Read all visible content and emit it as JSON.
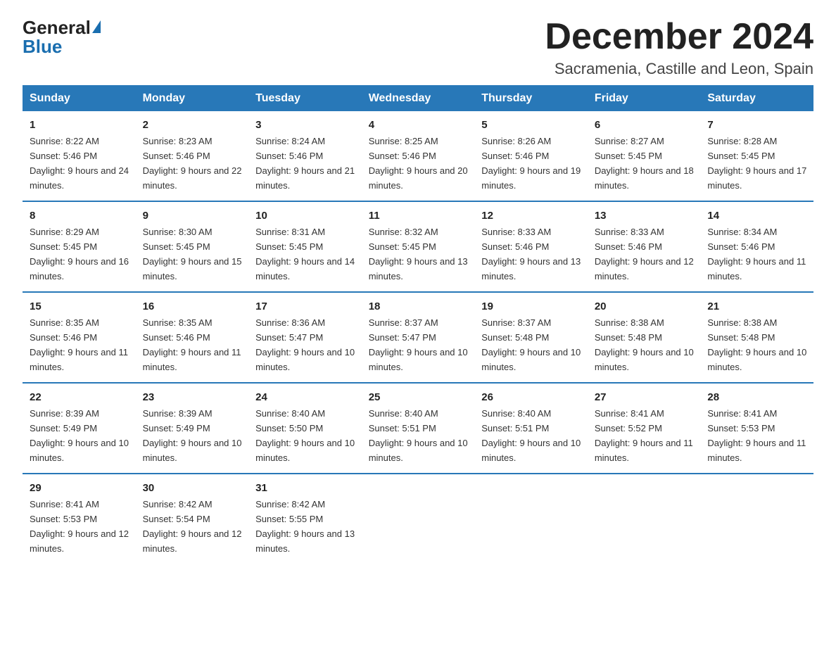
{
  "logo": {
    "general": "General",
    "blue": "Blue"
  },
  "header": {
    "month_title": "December 2024",
    "location": "Sacramenia, Castille and Leon, Spain"
  },
  "weekdays": [
    "Sunday",
    "Monday",
    "Tuesday",
    "Wednesday",
    "Thursday",
    "Friday",
    "Saturday"
  ],
  "weeks": [
    [
      {
        "day": "1",
        "sunrise": "8:22 AM",
        "sunset": "5:46 PM",
        "daylight": "9 hours and 24 minutes."
      },
      {
        "day": "2",
        "sunrise": "8:23 AM",
        "sunset": "5:46 PM",
        "daylight": "9 hours and 22 minutes."
      },
      {
        "day": "3",
        "sunrise": "8:24 AM",
        "sunset": "5:46 PM",
        "daylight": "9 hours and 21 minutes."
      },
      {
        "day": "4",
        "sunrise": "8:25 AM",
        "sunset": "5:46 PM",
        "daylight": "9 hours and 20 minutes."
      },
      {
        "day": "5",
        "sunrise": "8:26 AM",
        "sunset": "5:46 PM",
        "daylight": "9 hours and 19 minutes."
      },
      {
        "day": "6",
        "sunrise": "8:27 AM",
        "sunset": "5:45 PM",
        "daylight": "9 hours and 18 minutes."
      },
      {
        "day": "7",
        "sunrise": "8:28 AM",
        "sunset": "5:45 PM",
        "daylight": "9 hours and 17 minutes."
      }
    ],
    [
      {
        "day": "8",
        "sunrise": "8:29 AM",
        "sunset": "5:45 PM",
        "daylight": "9 hours and 16 minutes."
      },
      {
        "day": "9",
        "sunrise": "8:30 AM",
        "sunset": "5:45 PM",
        "daylight": "9 hours and 15 minutes."
      },
      {
        "day": "10",
        "sunrise": "8:31 AM",
        "sunset": "5:45 PM",
        "daylight": "9 hours and 14 minutes."
      },
      {
        "day": "11",
        "sunrise": "8:32 AM",
        "sunset": "5:45 PM",
        "daylight": "9 hours and 13 minutes."
      },
      {
        "day": "12",
        "sunrise": "8:33 AM",
        "sunset": "5:46 PM",
        "daylight": "9 hours and 13 minutes."
      },
      {
        "day": "13",
        "sunrise": "8:33 AM",
        "sunset": "5:46 PM",
        "daylight": "9 hours and 12 minutes."
      },
      {
        "day": "14",
        "sunrise": "8:34 AM",
        "sunset": "5:46 PM",
        "daylight": "9 hours and 11 minutes."
      }
    ],
    [
      {
        "day": "15",
        "sunrise": "8:35 AM",
        "sunset": "5:46 PM",
        "daylight": "9 hours and 11 minutes."
      },
      {
        "day": "16",
        "sunrise": "8:35 AM",
        "sunset": "5:46 PM",
        "daylight": "9 hours and 11 minutes."
      },
      {
        "day": "17",
        "sunrise": "8:36 AM",
        "sunset": "5:47 PM",
        "daylight": "9 hours and 10 minutes."
      },
      {
        "day": "18",
        "sunrise": "8:37 AM",
        "sunset": "5:47 PM",
        "daylight": "9 hours and 10 minutes."
      },
      {
        "day": "19",
        "sunrise": "8:37 AM",
        "sunset": "5:48 PM",
        "daylight": "9 hours and 10 minutes."
      },
      {
        "day": "20",
        "sunrise": "8:38 AM",
        "sunset": "5:48 PM",
        "daylight": "9 hours and 10 minutes."
      },
      {
        "day": "21",
        "sunrise": "8:38 AM",
        "sunset": "5:48 PM",
        "daylight": "9 hours and 10 minutes."
      }
    ],
    [
      {
        "day": "22",
        "sunrise": "8:39 AM",
        "sunset": "5:49 PM",
        "daylight": "9 hours and 10 minutes."
      },
      {
        "day": "23",
        "sunrise": "8:39 AM",
        "sunset": "5:49 PM",
        "daylight": "9 hours and 10 minutes."
      },
      {
        "day": "24",
        "sunrise": "8:40 AM",
        "sunset": "5:50 PM",
        "daylight": "9 hours and 10 minutes."
      },
      {
        "day": "25",
        "sunrise": "8:40 AM",
        "sunset": "5:51 PM",
        "daylight": "9 hours and 10 minutes."
      },
      {
        "day": "26",
        "sunrise": "8:40 AM",
        "sunset": "5:51 PM",
        "daylight": "9 hours and 10 minutes."
      },
      {
        "day": "27",
        "sunrise": "8:41 AM",
        "sunset": "5:52 PM",
        "daylight": "9 hours and 11 minutes."
      },
      {
        "day": "28",
        "sunrise": "8:41 AM",
        "sunset": "5:53 PM",
        "daylight": "9 hours and 11 minutes."
      }
    ],
    [
      {
        "day": "29",
        "sunrise": "8:41 AM",
        "sunset": "5:53 PM",
        "daylight": "9 hours and 12 minutes."
      },
      {
        "day": "30",
        "sunrise": "8:42 AM",
        "sunset": "5:54 PM",
        "daylight": "9 hours and 12 minutes."
      },
      {
        "day": "31",
        "sunrise": "8:42 AM",
        "sunset": "5:55 PM",
        "daylight": "9 hours and 13 minutes."
      },
      null,
      null,
      null,
      null
    ]
  ]
}
